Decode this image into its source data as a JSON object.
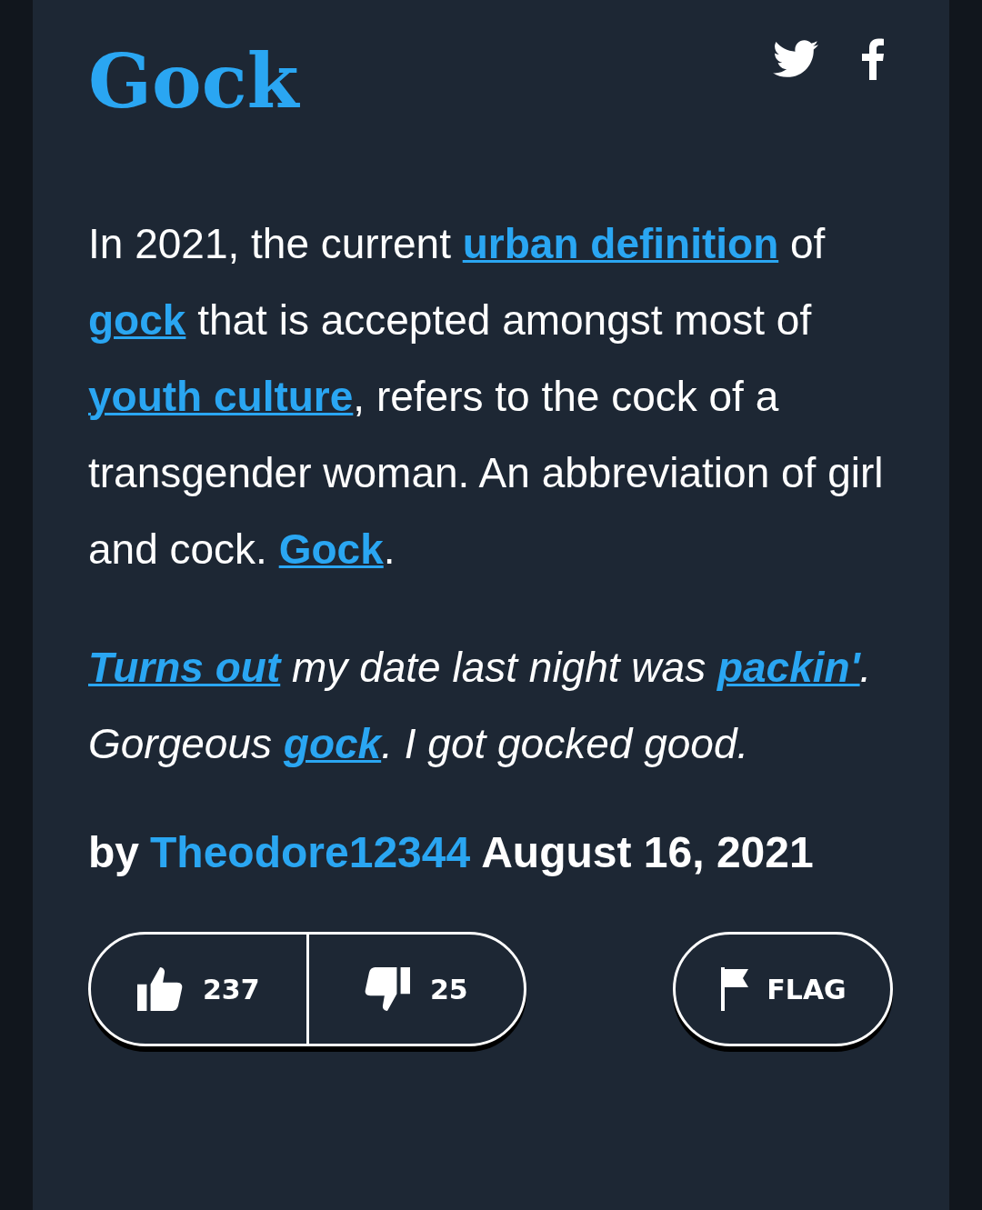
{
  "title": "Gock",
  "definition": [
    {
      "text": "In 2021, the current ",
      "link": false
    },
    {
      "text": "urban definition",
      "link": true
    },
    {
      "text": " of ",
      "link": false
    },
    {
      "text": "gock",
      "link": true
    },
    {
      "text": " that is accepted amongst most of ",
      "link": false
    },
    {
      "text": "youth culture",
      "link": true
    },
    {
      "text": ", refers to the cock of a transgender woman. An abbreviation of girl and cock. ",
      "link": false
    },
    {
      "text": "Gock",
      "link": true
    },
    {
      "text": ".",
      "link": false
    }
  ],
  "example": [
    {
      "text": "Turns out",
      "link": true
    },
    {
      "text": " my date last night was ",
      "link": false
    },
    {
      "text": "packin'",
      "link": true
    },
    {
      "text": ". Gorgeous ",
      "link": false
    },
    {
      "text": "gock",
      "link": true
    },
    {
      "text": ". I got gocked good.",
      "link": false
    }
  ],
  "byline": {
    "prefix": "by",
    "author": "Theodore12344",
    "date": "August 16, 2021"
  },
  "votes": {
    "up": "237",
    "down": "25"
  },
  "flag": "FLAG"
}
